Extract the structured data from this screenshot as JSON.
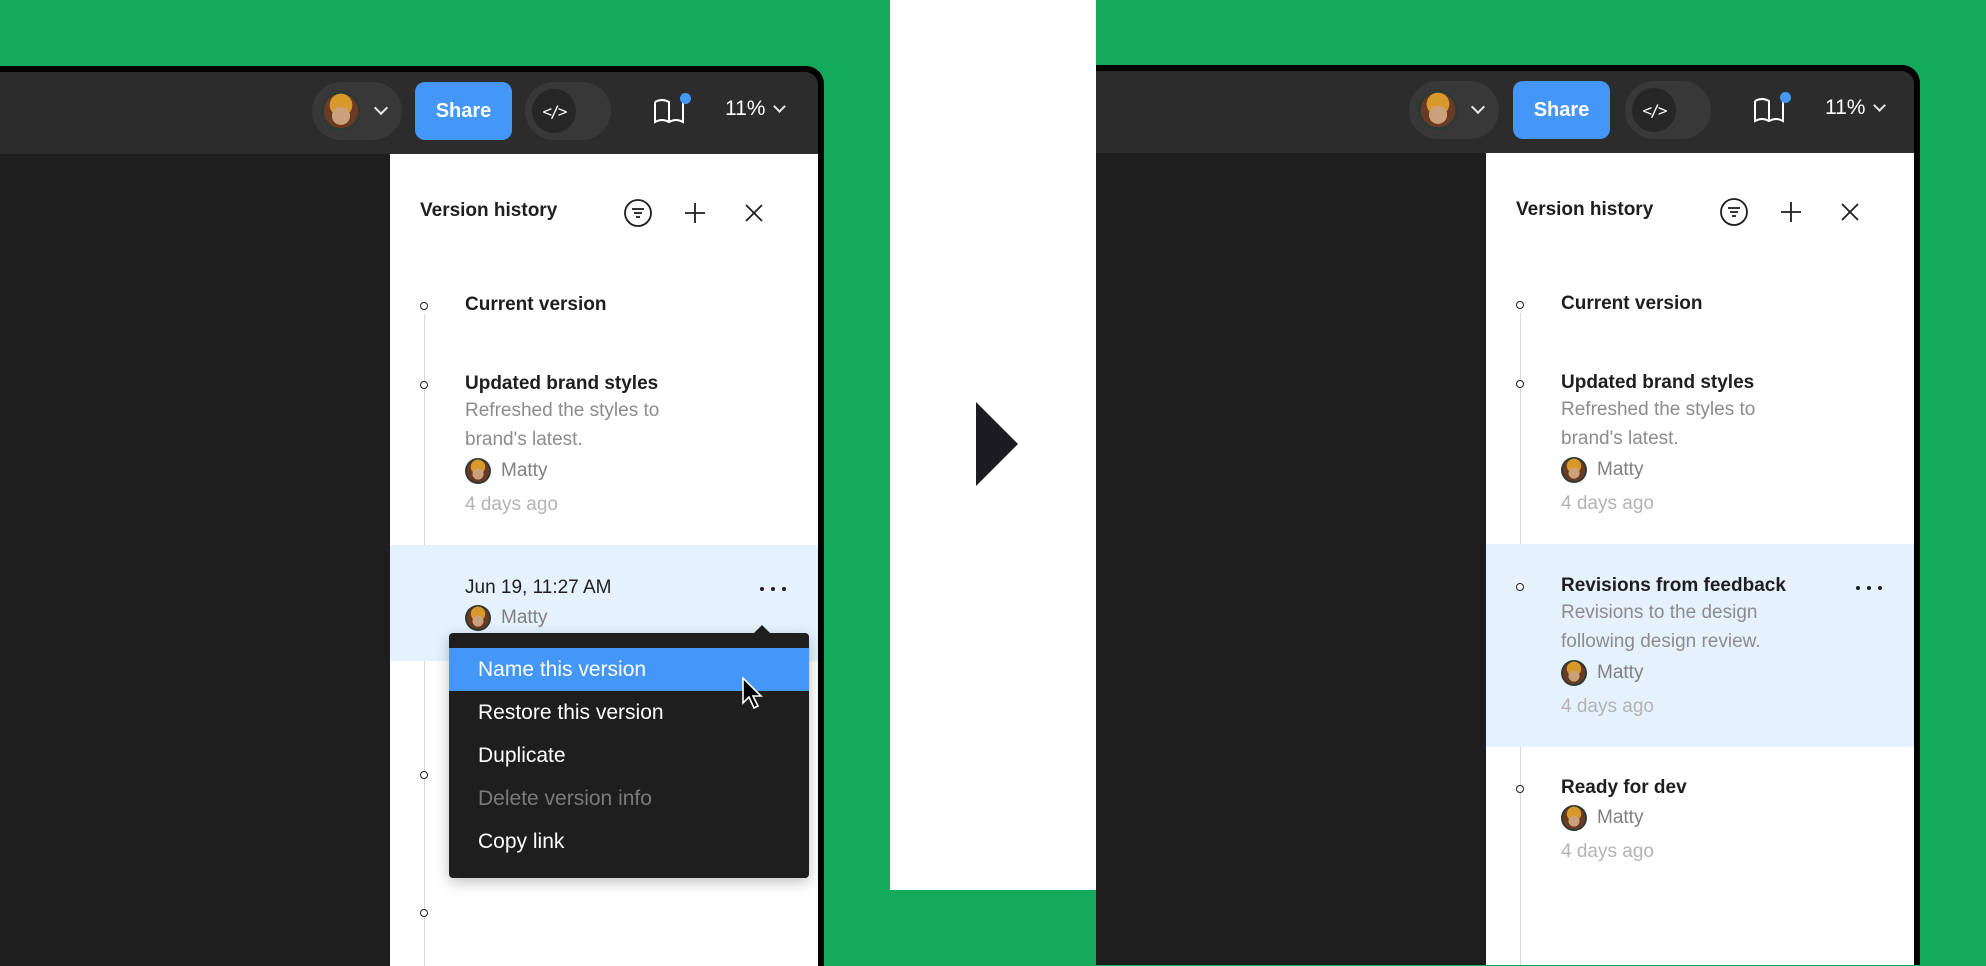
{
  "toolbar": {
    "share_label": "Share",
    "code_toggle_glyph": "</>",
    "zoom_level": "11%"
  },
  "transition_arrow": "right-triangle",
  "before": {
    "panel_title": "Version history",
    "header_icons": [
      "filter-icon",
      "plus-icon",
      "close-icon"
    ],
    "items": [
      {
        "title": "Current version"
      },
      {
        "title": "Updated brand styles",
        "description": "Refreshed the styles to brand's latest.",
        "author": "Matty",
        "time": "4 days ago"
      },
      {
        "title": "Jun 19, 11:27 AM",
        "author": "Matty",
        "selected": true
      }
    ],
    "context_menu": {
      "items": [
        {
          "label": "Name this version",
          "state": "hover"
        },
        {
          "label": "Restore this version",
          "state": "normal"
        },
        {
          "label": "Duplicate",
          "state": "normal"
        },
        {
          "label": "Delete version info",
          "state": "disabled"
        },
        {
          "label": "Copy link",
          "state": "normal"
        }
      ]
    }
  },
  "after": {
    "panel_title": "Version history",
    "header_icons": [
      "filter-icon",
      "plus-icon",
      "close-icon"
    ],
    "items": [
      {
        "title": "Current version"
      },
      {
        "title": "Updated brand styles",
        "description": "Refreshed the styles to brand's latest.",
        "author": "Matty",
        "time": "4 days ago"
      },
      {
        "title": "Revisions from feedback",
        "description": "Revisions to the design following design review.",
        "author": "Matty",
        "time": "4 days ago",
        "selected": true
      },
      {
        "title": "Ready for dev",
        "author": "Matty",
        "time": "4 days ago"
      }
    ]
  },
  "colors": {
    "background_green": "#12aa5a",
    "accent_blue": "#4497f7",
    "selected_row": "#e5f2fd",
    "toolbar_dark": "#2c2c2c",
    "canvas_dark": "#1e1e1e"
  }
}
